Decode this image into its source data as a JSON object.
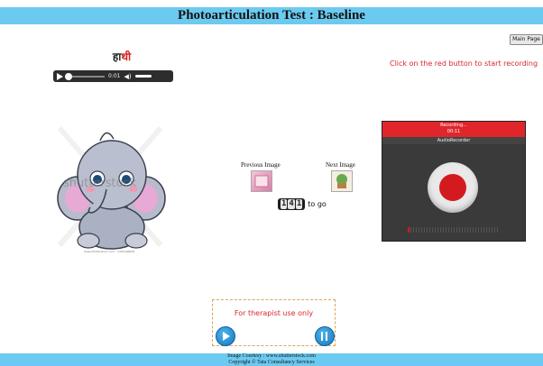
{
  "header": {
    "title": "Photoarticulation Test : Baseline"
  },
  "nav": {
    "main_page": "Main Page"
  },
  "instruction": "Click on the red button to start recording",
  "word": {
    "part1": "हा",
    "part2": "थी"
  },
  "audio": {
    "time": "0:01",
    "progress": 0.05
  },
  "image": {
    "watermark": "shutterstock",
    "credit": "www.shutterstock.com · 1363166828"
  },
  "navigation": {
    "previous_label": "Previous Image",
    "next_label": "Next Image"
  },
  "counter": {
    "digits": [
      "1",
      "4",
      "1"
    ],
    "suffix": "to go"
  },
  "recorder": {
    "status": "Recording...",
    "timer": "00:11",
    "title": "AudioRecorder"
  },
  "therapist": {
    "label": "For therapist use only"
  },
  "footer": {
    "line1": "Image Courtesy : www.shutterstock.com",
    "line2": "Copyright © Tata Consultancy Services"
  },
  "colors": {
    "header_bg": "#6ccaf0",
    "accent_red": "#d7282f",
    "recorder_red": "#e0262b"
  }
}
